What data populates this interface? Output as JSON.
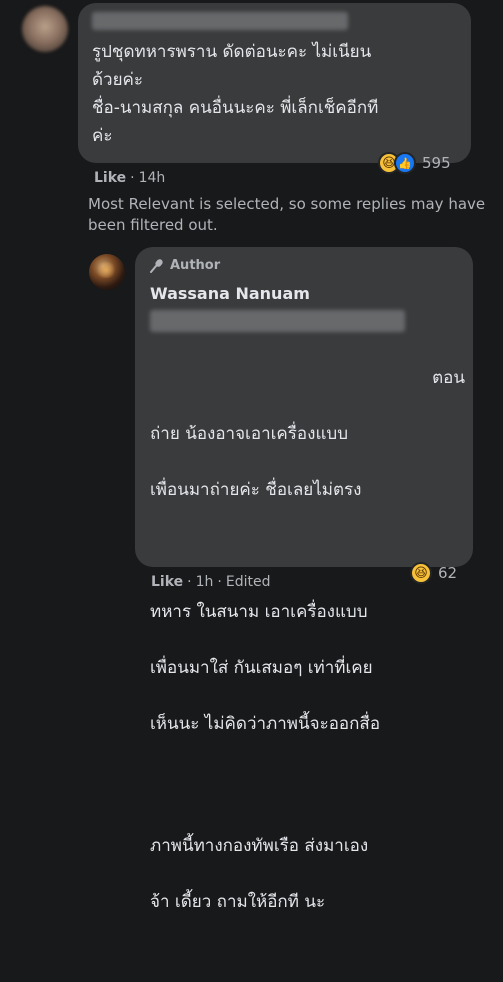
{
  "comment1": {
    "text": "รูปชุดทหารพราน ดัดต่อนะคะ ไม่เนียน\nด้วยค่ะ\nชื่อ-นามสกุล คนอื่นนะคะ พี่เล็กเช็คอีกที\nค่ะ",
    "reaction_count": "595",
    "like_label": "Like",
    "time": "14h"
  },
  "notice": "Most Relevant is selected, so some replies may have been filtered out.",
  "reply": {
    "badge": "Author",
    "author_name": "Wassana Nanuam",
    "line1_tail": "ตอน",
    "para1": [
      "ถ่าย น้องอาจเอาเครื่องแบบ",
      "เพื่อนมาถ่ายค่ะ ชื่อเลยไม่ตรง"
    ],
    "para2": [
      "ทหาร ในสนาม เอาเครื่องแบบ",
      "เพื่อนมาใส่ กันเสมอๆ เท่าที่เคย",
      "เห็นนะ ไม่คิดว่าภาพนี้จะออกสื่อ"
    ],
    "para3": [
      "ภาพนี้ทางกองทัพเรือ ส่งมาเอง",
      "จ้า เดี้ยว ถามให้อีกที นะ"
    ],
    "reaction_count": "62",
    "like_label": "Like",
    "time": "1h",
    "edited": "Edited"
  }
}
